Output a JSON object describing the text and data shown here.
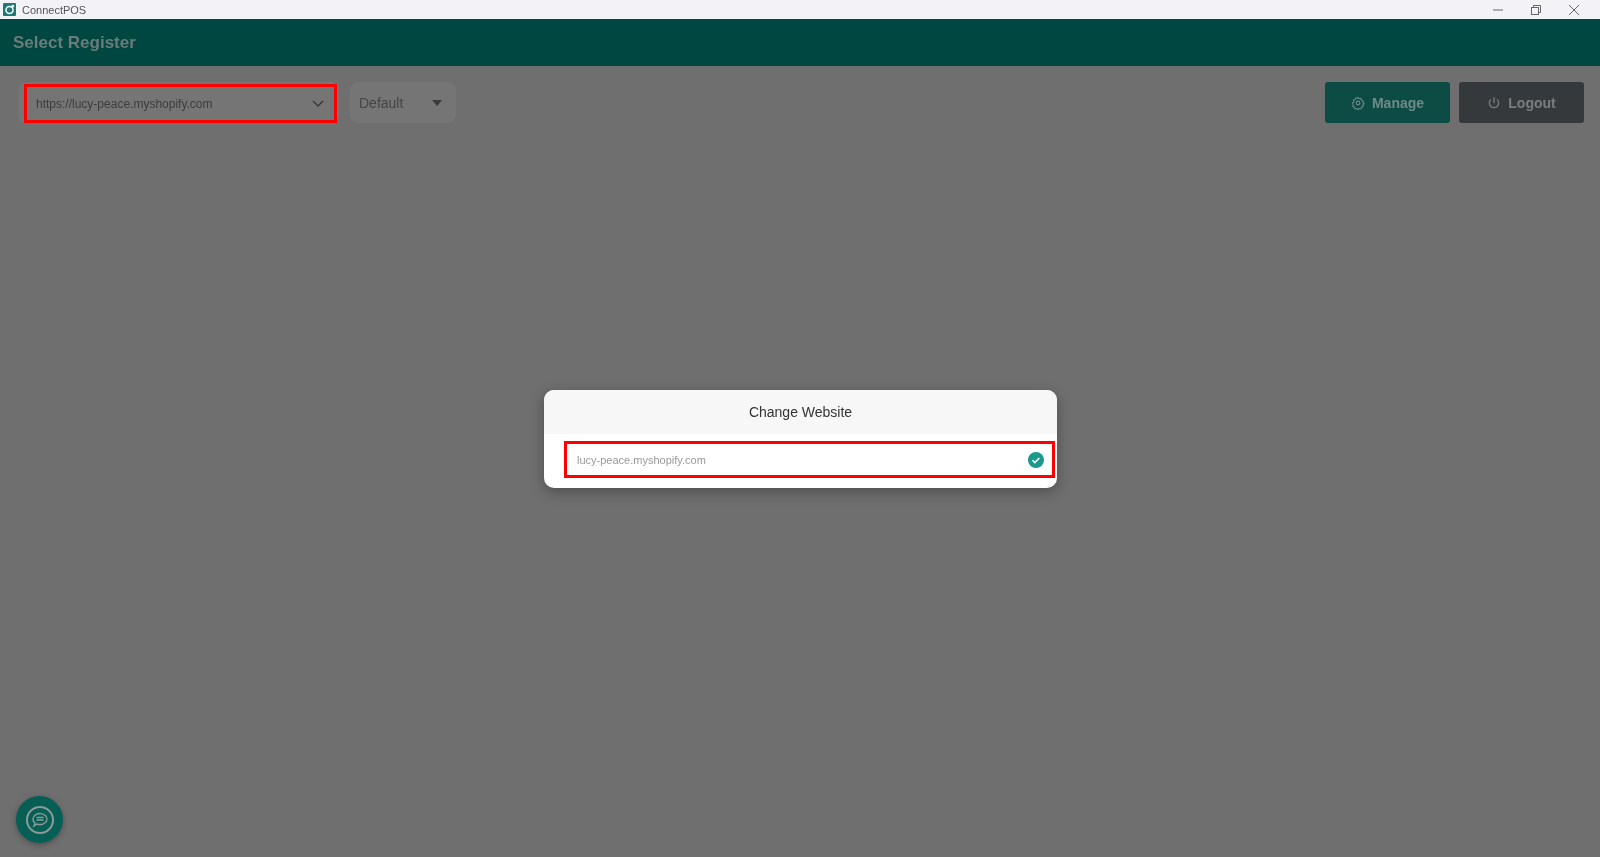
{
  "window": {
    "title": "ConnectPOS"
  },
  "header": {
    "title": "Select Register"
  },
  "toolbar": {
    "website_select": {
      "value": "https://lucy-peace.myshopify.com",
      "highlighted": true
    },
    "register_select": {
      "value": "Default"
    },
    "buttons": [
      {
        "label": "Manage",
        "kind": "manage"
      },
      {
        "label": "Logout",
        "kind": "logout"
      }
    ]
  },
  "dialog": {
    "title": "Change Website",
    "items": [
      {
        "label": "lucy-peace.myshopify.com",
        "selected": true,
        "highlighted": true
      }
    ]
  }
}
